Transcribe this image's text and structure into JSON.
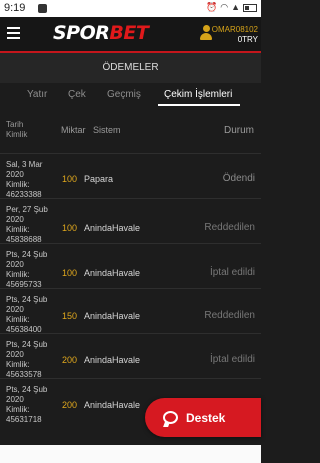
{
  "status_bar": {
    "time": "9:19"
  },
  "header": {
    "logo_white": "SPOR",
    "logo_red": "BET",
    "username": "OMAR08102",
    "balance": "0TRY"
  },
  "page": {
    "title": "ÖDEMELER"
  },
  "tabs": [
    {
      "label": "Yatır"
    },
    {
      "label": "Çek"
    },
    {
      "label": "Geçmiş"
    },
    {
      "label": "Çekim İşlemleri",
      "active": true
    }
  ],
  "table": {
    "headers": {
      "tarih": "Tarih",
      "kimlik": "Kimlik",
      "miktar": "Miktar",
      "sistem": "Sistem",
      "durum": "Durum"
    },
    "rows": [
      {
        "date": "Sal, 3 Mar 2020",
        "id_label": "Kimlik:",
        "id": "46233388",
        "amount": "100",
        "system": "Papara",
        "status": "Ödendi"
      },
      {
        "date": "Per, 27 Şub 2020",
        "id_label": "Kimlik:",
        "id": "45838688",
        "amount": "100",
        "system": "AnindaHavale",
        "status": "Reddedilen"
      },
      {
        "date": "Pts, 24 Şub 2020",
        "id_label": "Kimlik:",
        "id": "45695733",
        "amount": "100",
        "system": "AnindaHavale",
        "status": "İptal edildi"
      },
      {
        "date": "Pts, 24 Şub 2020",
        "id_label": "Kimlik:",
        "id": "45638400",
        "amount": "150",
        "system": "AnindaHavale",
        "status": "Reddedilen"
      },
      {
        "date": "Pts, 24 Şub 2020",
        "id_label": "Kimlik:",
        "id": "45633578",
        "amount": "200",
        "system": "AnindaHavale",
        "status": "İptal edildi"
      },
      {
        "date": "Pts, 24 Şub 2020",
        "id_label": "Kimlik:",
        "id": "45631718",
        "amount": "200",
        "system": "AnindaHavale",
        "status": ""
      }
    ]
  },
  "support": {
    "label": "Destek"
  }
}
